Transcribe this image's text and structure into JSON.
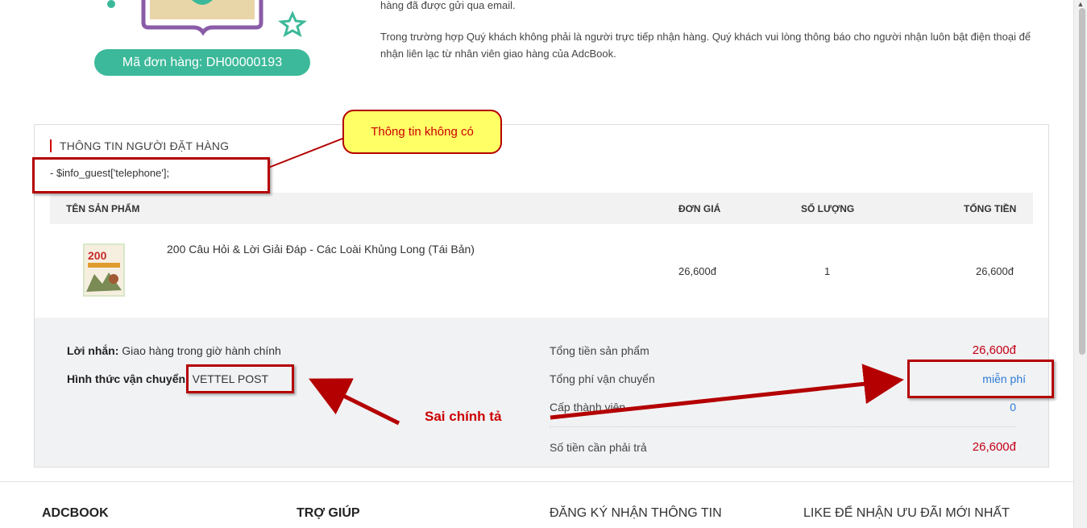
{
  "order": {
    "badge": "Mã đơn hàng: DH00000193"
  },
  "intro": {
    "line0": "hàng đã được gửi qua email.",
    "line1": "Trong trường hợp Quý khách không phải là người trực tiếp nhận hàng. Quý khách vui lòng thông báo cho người nhận luôn bật điện thoại để",
    "line2": "nhận liên lạc từ nhân viên giao hàng của AdcBook."
  },
  "buyer": {
    "section_title": "THÔNG TIN NGƯỜI ĐẶT HÀNG",
    "guest_line": "- $info_guest['telephone'];"
  },
  "table": {
    "headers": [
      "TÊN SẢN PHẨM",
      "ĐƠN GIÁ",
      "SỐ LƯỢNG",
      "TỔNG TIỀN"
    ],
    "rows": [
      {
        "name": "200 Câu Hỏi & Lời Giải Đáp - Các Loài Khủng Long (Tái Bản)",
        "price": "26,600đ",
        "qty": "1",
        "total": "26,600đ",
        "thumb_text": "200"
      }
    ]
  },
  "summary": {
    "note_label": "Lời nhắn:",
    "note_value": "Giao hàng trong giờ hành chính",
    "shipping_label": "Hình thức vận chuyển:",
    "shipping_value": "VETTEL POST",
    "subtotal_label": "Tổng tiền sản phẩm",
    "subtotal_value": "26,600đ",
    "shipfee_label": "Tổng phí vận chuyển",
    "shipfee_value": "miễn phí",
    "member_label": "Cấp thành viên",
    "member_value": "0",
    "pay_label": "Số tiền cần phải trả",
    "pay_value": "26,600đ"
  },
  "footer": {
    "col1": "ADCBOOK",
    "col2": "TRỢ GIÚP",
    "col3": "ĐĂNG KÝ NHẬN THÔNG TIN",
    "col4": "LIKE ĐỂ NHẬN ƯU ĐÃI MỚI NHẤT"
  },
  "annotations": {
    "callout": "Thông tin không có",
    "typo": "Sai chính tả"
  },
  "colors": {
    "accent_green": "#3cb99a",
    "price_red": "#c20016",
    "annotation_red": "#b40000",
    "callout_yellow": "#ffff66"
  }
}
